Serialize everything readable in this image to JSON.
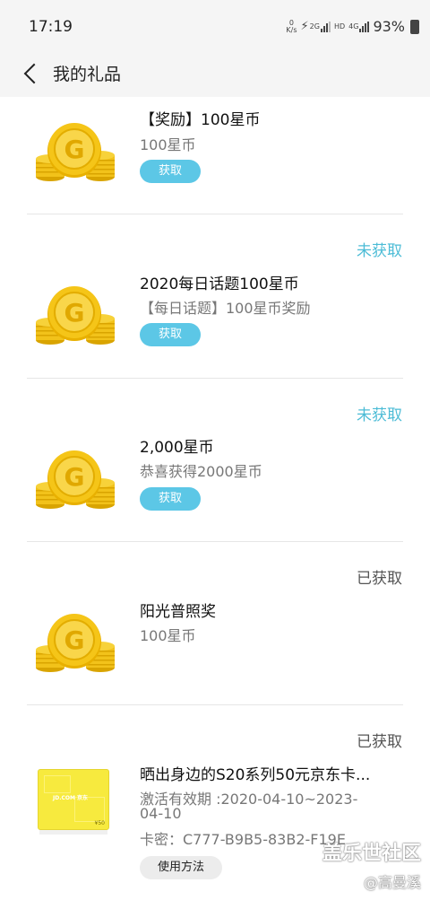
{
  "status_bar": {
    "time": "17:19",
    "net_speed_top": "0",
    "net_speed_bottom": "K/s",
    "net_2g": "2G",
    "hd": "HD",
    "net_4g": "4G",
    "battery": "93%"
  },
  "header": {
    "title": "我的礼品"
  },
  "gifts": [
    {
      "status": "",
      "title": "【奖励】100星币",
      "subtitle": "100星币",
      "button": "获取",
      "icon": "gold-coin-stack-icon"
    },
    {
      "status": "未获取",
      "title": "2020每日话题100星币",
      "subtitle": "【每日话题】100星币奖励",
      "button": "获取",
      "icon": "gold-coin-stack-icon"
    },
    {
      "status": "未获取",
      "title": "2,000星币",
      "subtitle": "恭喜获得2000星币",
      "button": "获取",
      "icon": "gold-coin-stack-icon"
    },
    {
      "status": "已获取",
      "title": "阳光普照奖",
      "subtitle": "100星币",
      "icon": "gold-coin-stack-icon"
    },
    {
      "status": "已获取",
      "title": "晒出身边的S20系列50元京东卡...",
      "subtitle_line1": "激活有效期 :2020-04-10~2023-",
      "subtitle_line2": "04-10",
      "subtitle_line3": "卡密：C777-B9B5-83B2-F19E",
      "button": "使用方法",
      "card_brand": "JD.COM 京东",
      "card_price": "¥50",
      "icon": "jd-gift-card-icon"
    }
  ],
  "watermark": {
    "line1": "盖乐世社区",
    "line2": "@高曼溪"
  },
  "colors": {
    "accent": "#5cc7e6",
    "status_pending": "#4cbcd6",
    "coin_gold": "#f2c21a"
  }
}
